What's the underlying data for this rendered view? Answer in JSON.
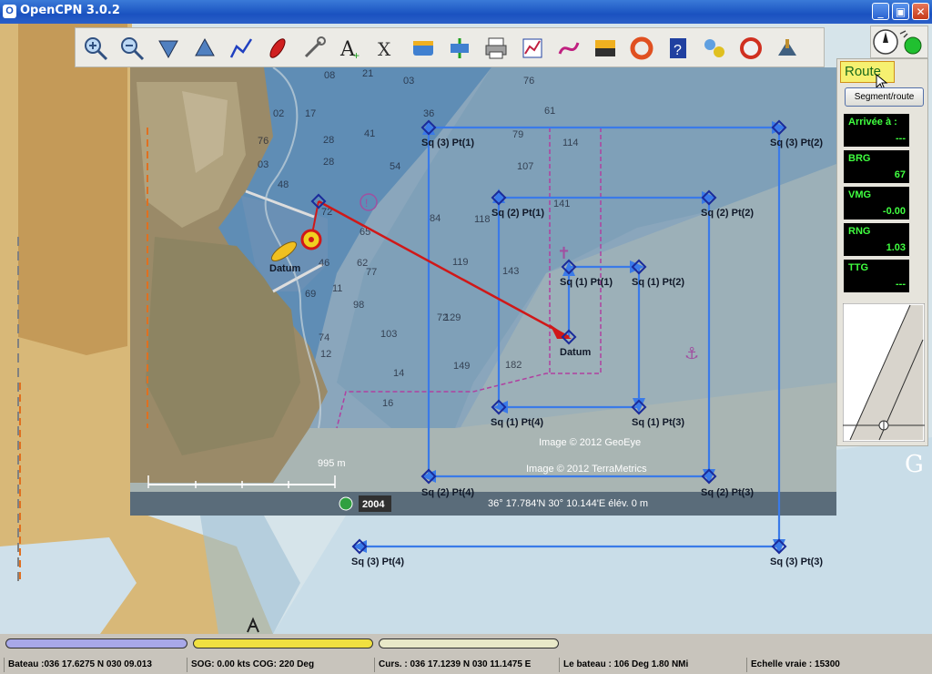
{
  "window": {
    "title": "OpenCPN 3.0.2",
    "minimize": "_",
    "maximize": "▣",
    "close": "✕"
  },
  "toolbar": {
    "items": [
      {
        "icon": "zoom-in-icon"
      },
      {
        "icon": "zoom-out-icon"
      },
      {
        "icon": "scale-down-icon"
      },
      {
        "icon": "scale-up-icon"
      },
      {
        "icon": "route-icon"
      },
      {
        "icon": "auto-follow-icon"
      },
      {
        "icon": "settings-icon"
      },
      {
        "icon": "text-icon"
      },
      {
        "icon": "current-icon"
      },
      {
        "icon": "tide-icon"
      },
      {
        "icon": "depth-icon"
      },
      {
        "icon": "print-icon"
      },
      {
        "icon": "route-manager-icon"
      },
      {
        "icon": "track-icon"
      },
      {
        "icon": "color-scheme-icon"
      },
      {
        "icon": "mob-icon"
      },
      {
        "icon": "help-icon"
      },
      {
        "icon": "ais-icon"
      },
      {
        "icon": "lifebuoy-icon"
      },
      {
        "icon": "grib-icon"
      }
    ]
  },
  "panel": {
    "title": "Route",
    "segment_button": "Segment/route",
    "fields": [
      {
        "label": "Arrivée à :",
        "value": "---"
      },
      {
        "label": "BRG",
        "value": "67"
      },
      {
        "label": "VMG",
        "value": "-0.00"
      },
      {
        "label": "RNG",
        "value": "1.03"
      },
      {
        "label": "TTG",
        "value": "---"
      }
    ]
  },
  "map": {
    "waypoints": [
      {
        "label": "Datum"
      },
      {
        "label": "Datum"
      },
      {
        "label": "Sq (1) Pt(1)"
      },
      {
        "label": "Sq (1) Pt(2)"
      },
      {
        "label": "Sq (1) Pt(3)"
      },
      {
        "label": "Sq (1) Pt(4)"
      },
      {
        "label": "Sq (2) Pt(1)"
      },
      {
        "label": "Sq (2) Pt(2)"
      },
      {
        "label": "Sq (2) Pt(3)"
      },
      {
        "label": "Sq (2) Pt(4)"
      },
      {
        "label": "Sq (3) Pt(1)"
      },
      {
        "label": "Sq (3) Pt(2)"
      },
      {
        "label": "Sq (3) Pt(3)"
      },
      {
        "label": "Sq (3) Pt(4)"
      }
    ],
    "overlay": {
      "copyright_geoeye": "Image © 2012 GeoEye",
      "copyright_terrametrics": "Image © 2012 TerraMetrics",
      "scale_label": "995 m",
      "year": "2004",
      "coords": "36° 17.784'N  30° 10.144'E  élév.     0 m",
      "google_logo": "G"
    },
    "depths": [
      "08",
      "21",
      "03",
      "76",
      "02",
      "17",
      "36",
      "61",
      "76",
      "28",
      "03",
      "41",
      "79",
      "114",
      "48",
      "54",
      "107",
      "28",
      "65",
      "72",
      "118",
      "141",
      "84",
      "62",
      "77",
      "119",
      "46",
      "11",
      "72",
      "143",
      "69",
      "98",
      "129",
      "74",
      "103",
      "14",
      "12",
      "149",
      "182",
      "16"
    ]
  },
  "status": {
    "progress_colors": [
      "#a8a8e8",
      "#f0e040",
      "#e8e8c8"
    ],
    "boat": "Bateau :036 17.6275 N  030 09.013",
    "sog_cog": "SOG: 0.00 kts  COG:  220 Deg",
    "cursor": "Curs. : 036 17.1239 N 030 11.1475 E",
    "bearing": "Le bateau : 106 Deg   1.80 NMi",
    "scale": "Echelle vraie :     15300"
  },
  "colors": {
    "route": "#3a7ae8",
    "active_leg": "#d01818",
    "titlebar": "#1a52c0",
    "instrument_text": "#40ff40"
  }
}
